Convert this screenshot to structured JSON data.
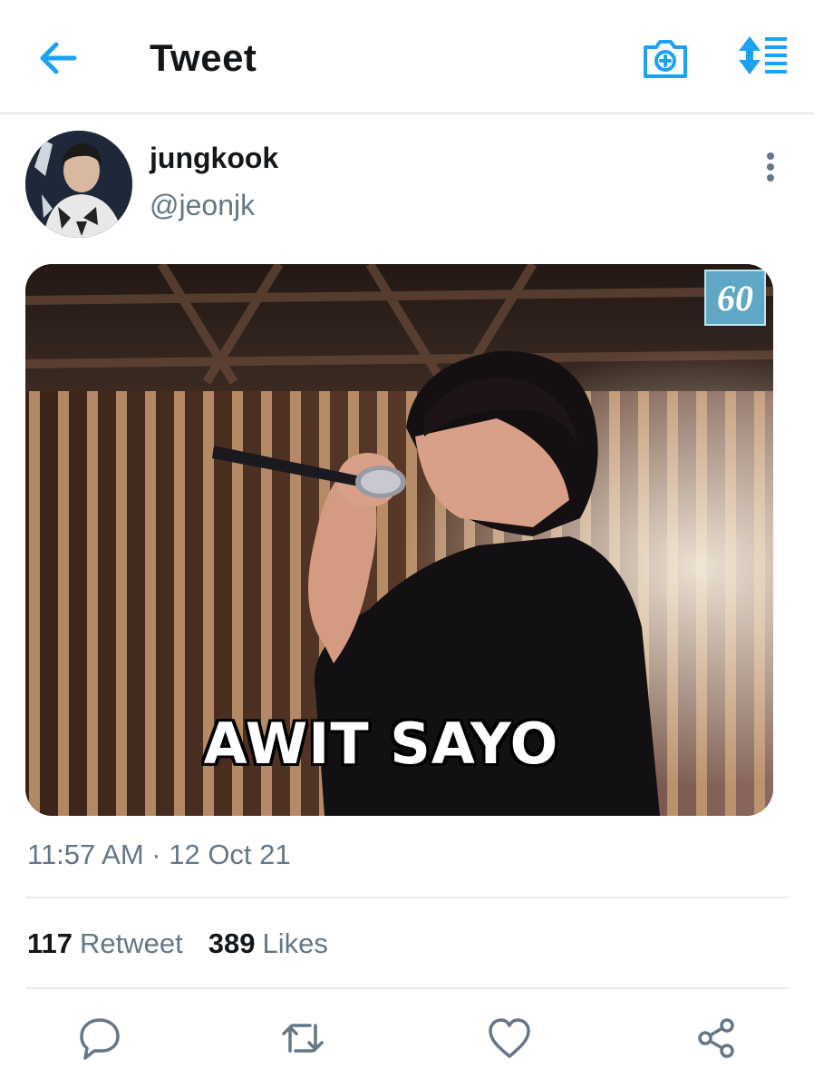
{
  "header": {
    "title": "Tweet",
    "accent_color": "#1da1f2",
    "icons": [
      "back-arrow-icon",
      "camera-icon",
      "sort-icon"
    ]
  },
  "tweet": {
    "author": {
      "name": "jungkook",
      "handle": "@jeonjk"
    },
    "media": {
      "caption": "AWIT SAYO",
      "logo_text": "60"
    },
    "timestamp": "11:57 AM · 12 Oct 21",
    "stats": {
      "retweets_count": "117",
      "retweets_label": "Retweet",
      "likes_count": "389",
      "likes_label": "Likes"
    },
    "actions": [
      "reply-icon",
      "retweet-icon",
      "like-icon",
      "share-icon"
    ]
  }
}
